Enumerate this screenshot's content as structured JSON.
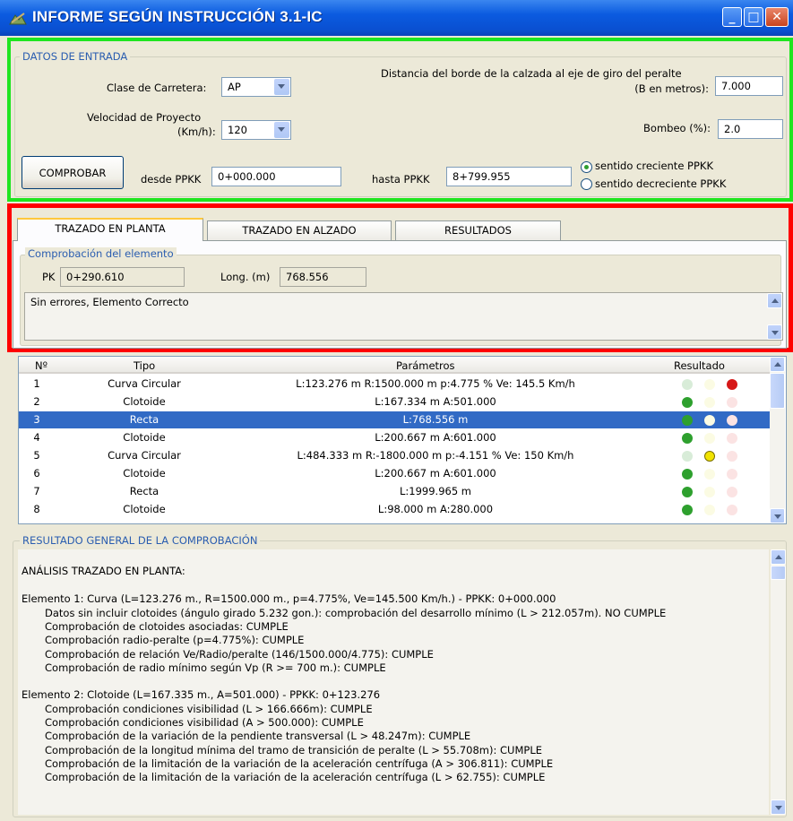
{
  "window": {
    "title": "INFORME SEGÚN INSTRUCCIÓN 3.1-IC"
  },
  "input": {
    "group_label": "DATOS DE ENTRADA",
    "clase_label": "Clase de Carretera:",
    "clase_value": "AP",
    "velocidad_label_1": "Velocidad de Proyecto",
    "velocidad_label_2": "(Km/h):",
    "velocidad_value": "120",
    "distancia_label_1": "Distancia del borde de la calzada al eje de giro del  peralte",
    "distancia_label_2": "(B en metros):",
    "distancia_value": "7.000",
    "bombeo_label": "Bombeo (%):",
    "bombeo_value": "2.0",
    "comprobar_label": "COMPROBAR",
    "desde_label": "desde PPKK",
    "desde_value": "0+000.000",
    "hasta_label": "hasta PPKK",
    "hasta_value": "8+799.955",
    "radio_creciente": "sentido creciente PPKK",
    "radio_decreciente": "sentido decreciente PPKK"
  },
  "tabs": [
    "TRAZADO EN PLANTA",
    "TRAZADO EN ALZADO",
    "RESULTADOS"
  ],
  "check": {
    "group_label": "Comprobación del elemento",
    "pk_label": "PK",
    "pk_value": "0+290.610",
    "long_label": "Long. (m)",
    "long_value": "768.556",
    "message": "Sin errores, Elemento Correcto"
  },
  "table": {
    "headers": [
      "Nº",
      "Tipo",
      "Parámetros",
      "Resultado"
    ],
    "rows": [
      {
        "n": "1",
        "tipo": "Curva Circular",
        "params": "L:123.276 m   R:1500.000 m   p:4.775 %   Ve: 145.5 Km/h",
        "result": "red"
      },
      {
        "n": "2",
        "tipo": "Clotoide",
        "params": "L:167.334 m   A:501.000",
        "result": "green"
      },
      {
        "n": "3",
        "tipo": "Recta",
        "params": "L:768.556 m",
        "result": "green"
      },
      {
        "n": "4",
        "tipo": "Clotoide",
        "params": "L:200.667 m   A:601.000",
        "result": "green"
      },
      {
        "n": "5",
        "tipo": "Curva Circular",
        "params": "L:484.333 m   R:-1800.000 m   p:-4.151 %   Ve: 150 Km/h",
        "result": "yellow"
      },
      {
        "n": "6",
        "tipo": "Clotoide",
        "params": "L:200.667 m   A:601.000",
        "result": "green"
      },
      {
        "n": "7",
        "tipo": "Recta",
        "params": "L:1999.965 m",
        "result": "green"
      },
      {
        "n": "8",
        "tipo": "Clotoide",
        "params": "L:98.000 m   A:280.000",
        "result": "green"
      }
    ]
  },
  "report": {
    "group_label": "RESULTADO GENERAL DE LA COMPROBACIÓN",
    "lines": [
      "ANÁLISIS TRAZADO EN PLANTA:",
      "",
      "Elemento 1: Curva (L=123.276 m., R=1500.000 m., p=4.775%, Ve=145.500 Km/h.) - PPKK: 0+000.000",
      "Datos sin incluir clotoides (ángulo girado 5.232 gon.):  comprobación del desarrollo mínimo (L > 212.057m). NO CUMPLE",
      "Comprobación de clotoides asociadas: CUMPLE",
      "Comprobación radio-peralte (p=4.775%): CUMPLE",
      "Comprobación de relación Ve/Radio/peralte (146/1500.000/4.775): CUMPLE",
      "Comprobación de radio mínimo según Vp (R >= 700 m.): CUMPLE",
      "",
      "Elemento 2: Clotoide (L=167.335 m., A=501.000) - PPKK: 0+123.276",
      "Comprobación condiciones visibilidad (L > 166.666m): CUMPLE",
      "Comprobación condiciones visibilidad (A > 500.000): CUMPLE",
      "Comprobación de la variación de la pendiente transversal (L > 48.247m): CUMPLE",
      "Comprobación de la longitud mínima del tramo de transición de peralte (L > 55.708m): CUMPLE",
      "Comprobación de la limitación de la variación de la aceleración centrífuga (A > 306.811): CUMPLE",
      "Comprobación de la limitación de la variación de la aceleración centrífuga (L > 62.755): CUMPLE"
    ]
  },
  "colors": {
    "highlight_green": "#1fe51f",
    "highlight_red": "#ff0000",
    "selection": "#316ac5"
  }
}
